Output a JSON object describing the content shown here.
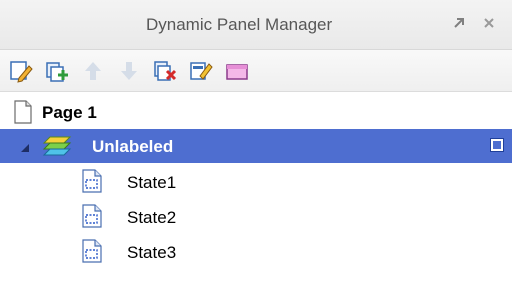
{
  "window": {
    "title": "Dynamic Panel Manager"
  },
  "toolbar": {
    "buttons": [
      {
        "name": "edit-panel",
        "icon": "edit-icon"
      },
      {
        "name": "add-state",
        "icon": "add-state-icon"
      },
      {
        "name": "move-up",
        "icon": "arrow-up-icon"
      },
      {
        "name": "move-down",
        "icon": "arrow-down-icon"
      },
      {
        "name": "delete-state",
        "icon": "delete-icon"
      },
      {
        "name": "edit-state",
        "icon": "edit-state-icon"
      },
      {
        "name": "state-properties",
        "icon": "properties-icon"
      }
    ]
  },
  "tree": {
    "page_label": "Page 1",
    "panel_label": "Unlabeled",
    "states": [
      "State1",
      "State2",
      "State3"
    ]
  },
  "colors": {
    "selection": "#4e6ed0",
    "title_text": "#575757"
  }
}
